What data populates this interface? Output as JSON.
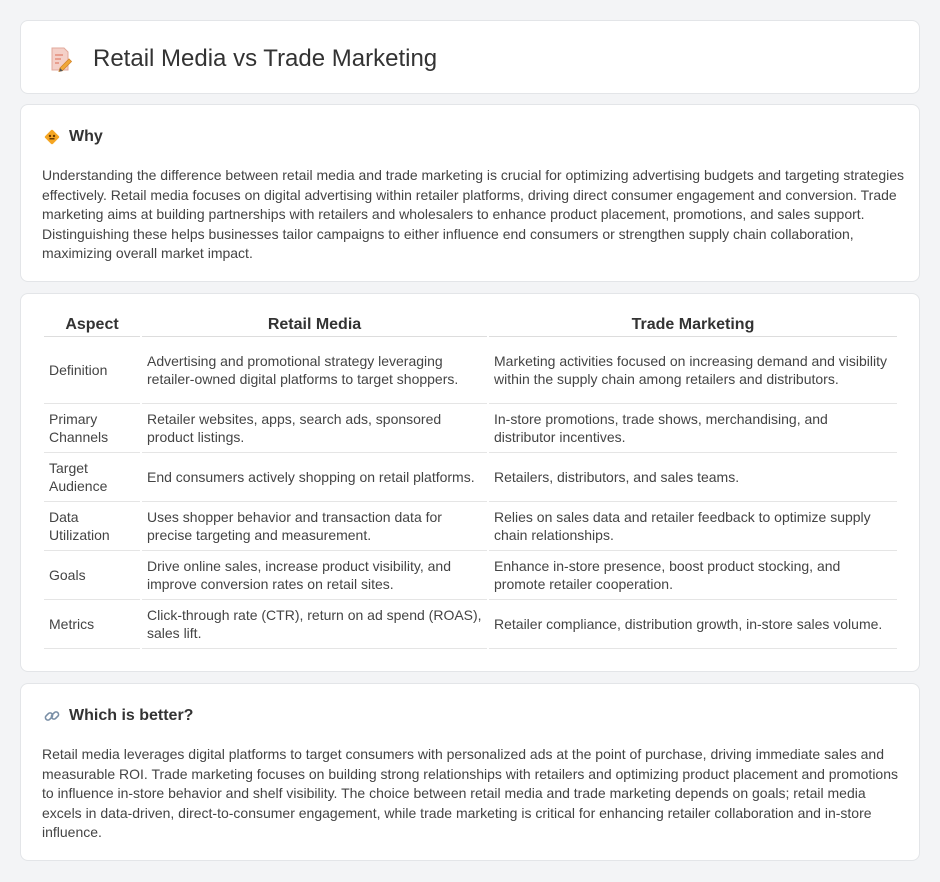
{
  "page": {
    "title": "Retail Media vs Trade Marketing",
    "title_icon": "document-pencil-icon"
  },
  "why": {
    "heading": "Why",
    "icon": "diamond-sign-icon",
    "text": "Understanding the difference between retail media and trade marketing is crucial for optimizing advertising budgets and targeting strategies effectively. Retail media focuses on digital advertising within retailer platforms, driving direct consumer engagement and conversion. Trade marketing aims at building partnerships with retailers and wholesalers to enhance product placement, promotions, and sales support. Distinguishing these helps businesses tailor campaigns to either influence end consumers or strengthen supply chain collaboration, maximizing overall market impact."
  },
  "comparison": {
    "headers": [
      "Aspect",
      "Retail Media",
      "Trade Marketing"
    ],
    "rows": [
      {
        "aspect": "Definition",
        "retail_media": "Advertising and promotional strategy leveraging retailer-owned digital platforms to target shoppers.",
        "trade_marketing": "Marketing activities focused on increasing demand and visibility within the supply chain among retailers and distributors."
      },
      {
        "aspect": "Primary Channels",
        "retail_media": "Retailer websites, apps, search ads, sponsored product listings.",
        "trade_marketing": "In-store promotions, trade shows, merchandising, and distributor incentives."
      },
      {
        "aspect": "Target Audience",
        "retail_media": "End consumers actively shopping on retail platforms.",
        "trade_marketing": "Retailers, distributors, and sales teams."
      },
      {
        "aspect": "Data Utilization",
        "retail_media": "Uses shopper behavior and transaction data for precise targeting and measurement.",
        "trade_marketing": "Relies on sales data and retailer feedback to optimize supply chain relationships."
      },
      {
        "aspect": "Goals",
        "retail_media": "Drive online sales, increase product visibility, and improve conversion rates on retail sites.",
        "trade_marketing": "Enhance in-store presence, boost product stocking, and promote retailer cooperation."
      },
      {
        "aspect": "Metrics",
        "retail_media": "Click-through rate (CTR), return on ad spend (ROAS), sales lift.",
        "trade_marketing": "Retailer compliance, distribution growth, in-store sales volume."
      }
    ]
  },
  "better": {
    "heading": "Which is better?",
    "icon": "link-icon",
    "text": "Retail media leverages digital platforms to target consumers with personalized ads at the point of purchase, driving immediate sales and measurable ROI. Trade marketing focuses on building strong relationships with retailers and optimizing product placement and promotions to influence in-store behavior and shelf visibility. The choice between retail media and trade marketing depends on goals; retail media excels in data-driven, direct-to-consumer engagement, while trade marketing is critical for enhancing retailer collaboration and in-store influence."
  }
}
